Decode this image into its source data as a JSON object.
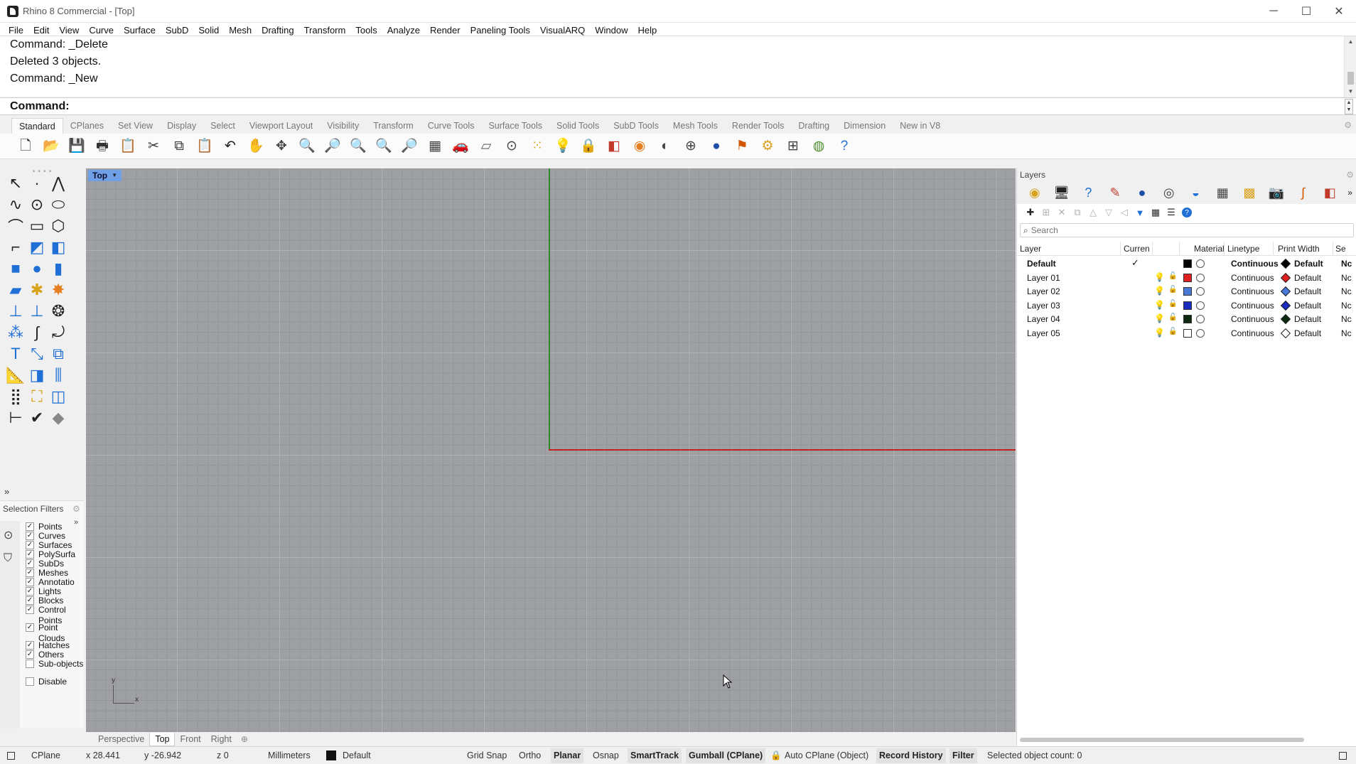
{
  "window": {
    "title": "Rhino 8 Commercial - [Top]",
    "controls": {
      "minimize": "─",
      "maximize": "☐",
      "close": "✕"
    }
  },
  "menu": [
    "File",
    "Edit",
    "View",
    "Curve",
    "Surface",
    "SubD",
    "Solid",
    "Mesh",
    "Drafting",
    "Transform",
    "Tools",
    "Analyze",
    "Render",
    "Paneling Tools",
    "VisualARQ",
    "Window",
    "Help"
  ],
  "command_history": [
    "Command: _Delete",
    "Deleted 3 objects.",
    "Command: _New"
  ],
  "command_prompt": "Command:",
  "command_input": "",
  "toolbar_tabs": [
    "Standard",
    "CPlanes",
    "Set View",
    "Display",
    "Select",
    "Viewport Layout",
    "Visibility",
    "Transform",
    "Curve Tools",
    "Surface Tools",
    "Solid Tools",
    "SubD Tools",
    "Mesh Tools",
    "Render Tools",
    "Drafting",
    "Dimension",
    "New in V8"
  ],
  "active_toolbar_tab": "Standard",
  "standard_tools": [
    {
      "name": "new-file-icon",
      "glyph": "🗋",
      "color": "#222222"
    },
    {
      "name": "open-folder-icon",
      "glyph": "📂",
      "color": "#d9a21b"
    },
    {
      "name": "save-icon",
      "glyph": "💾",
      "color": "#333333"
    },
    {
      "name": "print-icon",
      "glyph": "🖶",
      "color": "#333333"
    },
    {
      "name": "copy-to-clipboard-icon",
      "glyph": "📋",
      "color": "#333333"
    },
    {
      "name": "cut-icon",
      "glyph": "✂",
      "color": "#333333"
    },
    {
      "name": "copy-icon",
      "glyph": "⧉",
      "color": "#333333"
    },
    {
      "name": "paste-icon",
      "glyph": "📋",
      "color": "#d9a21b"
    },
    {
      "name": "undo-icon",
      "glyph": "↶",
      "color": "#222222"
    },
    {
      "name": "pan-hand-icon",
      "glyph": "✋",
      "color": "#444444"
    },
    {
      "name": "rotate-view-icon",
      "glyph": "✥",
      "color": "#444444"
    },
    {
      "name": "zoom-icon",
      "glyph": "🔍",
      "color": "#444444"
    },
    {
      "name": "zoom-window-icon",
      "glyph": "🔎",
      "color": "#444444"
    },
    {
      "name": "zoom-extents-icon",
      "glyph": "🔍",
      "color": "#444444"
    },
    {
      "name": "zoom-selected-icon",
      "glyph": "🔍",
      "color": "#b06020"
    },
    {
      "name": "undo-view-icon",
      "glyph": "🔎",
      "color": "#444444"
    },
    {
      "name": "four-viewports-icon",
      "glyph": "▦",
      "color": "#444444"
    },
    {
      "name": "car-icon",
      "glyph": "🚗",
      "color": "#c0392b"
    },
    {
      "name": "grid-plane-icon",
      "glyph": "▱",
      "color": "#666666"
    },
    {
      "name": "osnap-icon",
      "glyph": "⊙",
      "color": "#444444"
    },
    {
      "name": "select-points-icon",
      "glyph": "⁙",
      "color": "#d9a21b"
    },
    {
      "name": "light-bulb-icon",
      "glyph": "💡",
      "color": "#666666"
    },
    {
      "name": "lock-icon",
      "glyph": "🔒",
      "color": "#444444"
    },
    {
      "name": "layer-icon",
      "glyph": "◧",
      "color": "#c0392b"
    },
    {
      "name": "color-wheel-icon",
      "glyph": "◉",
      "color": "#e67e22"
    },
    {
      "name": "shaded-sphere-icon",
      "glyph": "◐",
      "color": "#444444"
    },
    {
      "name": "wireframe-sphere-icon",
      "glyph": "⊕",
      "color": "#444444"
    },
    {
      "name": "render-sphere-icon",
      "glyph": "●",
      "color": "#1f4ea8"
    },
    {
      "name": "flamingo-icon",
      "glyph": "⚑",
      "color": "#d35400"
    },
    {
      "name": "options-gear-icon",
      "glyph": "⚙",
      "color": "#d9a21b"
    },
    {
      "name": "dimension-tool-icon",
      "glyph": "⊞",
      "color": "#444444"
    },
    {
      "name": "globe-icon",
      "glyph": "◍",
      "color": "#4a8a2a"
    },
    {
      "name": "help-icon",
      "glyph": "?",
      "color": "#1f6fd6"
    }
  ],
  "left_tools": [
    {
      "name": "select-arrow-icon",
      "glyph": "↖",
      "color": "#222222"
    },
    {
      "name": "point-icon",
      "glyph": "·",
      "color": "#222222"
    },
    {
      "name": "polyline-icon",
      "glyph": "⋀",
      "color": "#222222"
    },
    {
      "name": "curve-icon",
      "glyph": "∿",
      "color": "#222222"
    },
    {
      "name": "circle-icon",
      "glyph": "⊙",
      "color": "#222222"
    },
    {
      "name": "ellipse-icon",
      "glyph": "⬭",
      "color": "#222222"
    },
    {
      "name": "arc-icon",
      "glyph": "⌒",
      "color": "#222222"
    },
    {
      "name": "rectangle-icon",
      "glyph": "▭",
      "color": "#222222"
    },
    {
      "name": "polygon-icon",
      "glyph": "⬡",
      "color": "#222222"
    },
    {
      "name": "fillet-curve-icon",
      "glyph": "⌐",
      "color": "#222222"
    },
    {
      "name": "surface-from-points-icon",
      "glyph": "◩",
      "color": "#1f6fd6"
    },
    {
      "name": "extrude-curve-icon",
      "glyph": "◧",
      "color": "#1f6fd6"
    },
    {
      "name": "box-solid-icon",
      "glyph": "■",
      "color": "#1f6fd6"
    },
    {
      "name": "boolean-union-icon",
      "glyph": "●",
      "color": "#1f6fd6"
    },
    {
      "name": "cylinder-icon",
      "glyph": "▮",
      "color": "#1f6fd6"
    },
    {
      "name": "mesh-plane-icon",
      "glyph": "▰",
      "color": "#1f6fd6"
    },
    {
      "name": "mesh-tools-icon",
      "glyph": "✱",
      "color": "#d9a21b"
    },
    {
      "name": "explode-icon",
      "glyph": "✸",
      "color": "#e67e22"
    },
    {
      "name": "trim-icon",
      "glyph": "⊥",
      "color": "#1f6fd6"
    },
    {
      "name": "split-icon",
      "glyph": "⊥",
      "color": "#1f6fd6"
    },
    {
      "name": "boolean-icon",
      "glyph": "❂",
      "color": "#222222"
    },
    {
      "name": "control-points-icon",
      "glyph": "⁂",
      "color": "#1f6fd6"
    },
    {
      "name": "rebuild-curve-icon",
      "glyph": "∫",
      "color": "#222222"
    },
    {
      "name": "blend-curve-icon",
      "glyph": "⤾",
      "color": "#222222"
    },
    {
      "name": "text-icon",
      "glyph": "T",
      "color": "#1f6fd6"
    },
    {
      "name": "scale-icon",
      "glyph": "⤡",
      "color": "#1f6fd6"
    },
    {
      "name": "group-icon",
      "glyph": "⧉",
      "color": "#1f6fd6"
    },
    {
      "name": "ruler-icon",
      "glyph": "📐",
      "color": "#1f6fd6"
    },
    {
      "name": "make-2d-icon",
      "glyph": "◨",
      "color": "#1f6fd6"
    },
    {
      "name": "array-polar-icon",
      "glyph": "⫼",
      "color": "#1f6fd6"
    },
    {
      "name": "array-grid-icon",
      "glyph": "⣿",
      "color": "#222222"
    },
    {
      "name": "block-icon",
      "glyph": "⛶",
      "color": "#d9a21b"
    },
    {
      "name": "clipping-plane-icon",
      "glyph": "◫",
      "color": "#1f6fd6"
    },
    {
      "name": "dimension-icon",
      "glyph": "⊢",
      "color": "#222222"
    },
    {
      "name": "check-icon",
      "glyph": "✔",
      "color": "#222222"
    },
    {
      "name": "eraser-icon",
      "glyph": "◆",
      "color": "#888888"
    }
  ],
  "left_tools_more": "»",
  "selection_filters": {
    "title": "Selection Filters",
    "items": [
      {
        "label": "Points",
        "checked": true
      },
      {
        "label": "Curves",
        "checked": true
      },
      {
        "label": "Surfaces",
        "checked": true
      },
      {
        "label": "PolySurfa",
        "checked": true
      },
      {
        "label": "SubDs",
        "checked": true
      },
      {
        "label": "Meshes",
        "checked": true
      },
      {
        "label": "Annotatio",
        "checked": true
      },
      {
        "label": "Lights",
        "checked": true
      },
      {
        "label": "Blocks",
        "checked": true
      },
      {
        "label": "Control Points",
        "checked": true
      },
      {
        "label": "Point Clouds",
        "checked": true
      },
      {
        "label": "Hatches",
        "checked": true
      },
      {
        "label": "Others",
        "checked": true
      },
      {
        "label": "Sub-objects",
        "checked": false
      },
      {
        "label": "Disable",
        "checked": false
      }
    ]
  },
  "viewport": {
    "label": "Top",
    "axis_labels": {
      "x": "x",
      "y": "y"
    },
    "colors": {
      "background": "#9ea0a4",
      "x_axis": "#c02020",
      "y_axis": "#2c8a2c",
      "label_bg": "#6f9fe6"
    }
  },
  "viewport_tabs": [
    "Perspective",
    "Top",
    "Front",
    "Right"
  ],
  "active_viewport_tab": "Top",
  "viewport_tab_add": "⊕",
  "layers_panel": {
    "title": "Layers",
    "panel_icons": [
      {
        "name": "layers-panel-icon",
        "glyph": "◉",
        "color": "#d9a21b"
      },
      {
        "name": "display-panel-icon",
        "glyph": "🖥",
        "color": "#222222"
      },
      {
        "name": "help-panel-icon",
        "glyph": "?",
        "color": "#1f6fd6"
      },
      {
        "name": "properties-panel-icon",
        "glyph": "✎",
        "color": "#c0392b"
      },
      {
        "name": "materials-panel-icon",
        "glyph": "●",
        "color": "#1f4ea8"
      },
      {
        "name": "environment-panel-icon",
        "glyph": "◎",
        "color": "#444444"
      },
      {
        "name": "ground-plane-panel-icon",
        "glyph": "◒",
        "color": "#1f6fd6"
      },
      {
        "name": "named-views-panel-icon",
        "glyph": "▦",
        "color": "#444444"
      },
      {
        "name": "textures-panel-icon",
        "glyph": "▩",
        "color": "#d9a21b"
      },
      {
        "name": "snapshots-panel-icon",
        "glyph": "📷",
        "color": "#222222"
      },
      {
        "name": "curve-panel-icon",
        "glyph": "∫",
        "color": "#d35400"
      },
      {
        "name": "sun-panel-icon",
        "glyph": "◧",
        "color": "#c0392b"
      }
    ],
    "panel_more": "»",
    "layer_tools": [
      {
        "name": "new-layer-icon",
        "glyph": "✚",
        "active": true
      },
      {
        "name": "new-sublayer-icon",
        "glyph": "⊞",
        "active": false
      },
      {
        "name": "delete-layer-icon",
        "glyph": "✕",
        "active": false
      },
      {
        "name": "copy-layer-icon",
        "glyph": "⧉",
        "active": false
      },
      {
        "name": "move-up-icon",
        "glyph": "△",
        "active": false
      },
      {
        "name": "move-down-icon",
        "glyph": "▽",
        "active": false
      },
      {
        "name": "move-parent-icon",
        "glyph": "◁",
        "active": false
      },
      {
        "name": "filter-icon",
        "glyph": "▼",
        "active": true
      },
      {
        "name": "table-view-icon",
        "glyph": "▦",
        "active": true
      },
      {
        "name": "menu-icon",
        "glyph": "☰",
        "active": true
      },
      {
        "name": "help-circle-icon",
        "glyph": "?",
        "active": true
      }
    ],
    "search_placeholder": "Search",
    "columns": [
      "Layer",
      "Curren",
      "Material",
      "Linetype",
      "Print Width",
      "Se"
    ],
    "rows": [
      {
        "name": "Default",
        "current": true,
        "color": "#000000",
        "linetype": "Continuous",
        "print_color": "#000000",
        "print_width": "Default",
        "section": "Nc"
      },
      {
        "name": "Layer 01",
        "current": false,
        "color": "#e02020",
        "linetype": "Continuous",
        "print_color": "#e02020",
        "print_width": "Default",
        "section": "Nc"
      },
      {
        "name": "Layer 02",
        "current": false,
        "color": "#4a78d8",
        "linetype": "Continuous",
        "print_color": "#4a78d8",
        "print_width": "Default",
        "section": "Nc"
      },
      {
        "name": "Layer 03",
        "current": false,
        "color": "#1a2bbf",
        "linetype": "Continuous",
        "print_color": "#1a2bbf",
        "print_width": "Default",
        "section": "Nc"
      },
      {
        "name": "Layer 04",
        "current": false,
        "color": "#0d2a10",
        "linetype": "Continuous",
        "print_color": "#0d2a10",
        "print_width": "Default",
        "section": "Nc"
      },
      {
        "name": "Layer 05",
        "current": false,
        "color": "#ffffff",
        "linetype": "Continuous",
        "print_color": "#ffffff",
        "print_width": "Default",
        "section": "Nc"
      }
    ]
  },
  "status_bar": {
    "cplane": "CPlane",
    "x": "x 28.441",
    "y": "y -26.942",
    "z": "z 0",
    "units": "Millimeters",
    "layer": "Default",
    "grid_snap": "Grid Snap",
    "ortho": "Ortho",
    "planar": "Planar",
    "osnap": "Osnap",
    "smarttrack": "SmartTrack",
    "gumball": "Gumball (CPlane)",
    "auto_cplane": "Auto CPlane (Object)",
    "record_history": "Record History",
    "filter": "Filter",
    "selected_count": "Selected object count: 0"
  }
}
